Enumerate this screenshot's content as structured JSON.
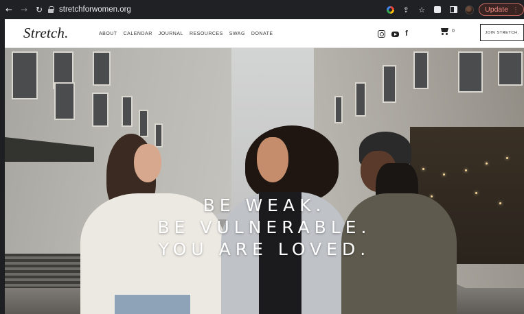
{
  "browser": {
    "url": "stretchforwomen.org",
    "update_label": "Update",
    "icons": [
      "back-arrow-icon",
      "forward-arrow-icon",
      "reload-icon",
      "lock-icon",
      "google-icon",
      "share-icon",
      "star-icon",
      "extensions-icon",
      "side-panel-icon",
      "profile-avatar",
      "menu-dots-icon"
    ]
  },
  "site": {
    "logo": "Stretch.",
    "nav": [
      {
        "label": "ABOUT"
      },
      {
        "label": "CALENDAR"
      },
      {
        "label": "JOURNAL"
      },
      {
        "label": "RESOURCES"
      },
      {
        "label": "SWAG"
      },
      {
        "label": "DONATE"
      }
    ],
    "social_icons": [
      "instagram-icon",
      "youtube-icon",
      "facebook-icon"
    ],
    "cart_count": "0",
    "join_label": "JOIN STRETCH."
  },
  "hero": {
    "lines": [
      "BE WEAK.",
      "BE VULNERABLE.",
      "YOU ARE LOVED."
    ]
  },
  "colors": {
    "chrome_bg": "#202124",
    "update_accent": "#f28b82",
    "header_bg": "#ffffff",
    "text_dark": "#222222",
    "hero_text": "#ffffff"
  }
}
